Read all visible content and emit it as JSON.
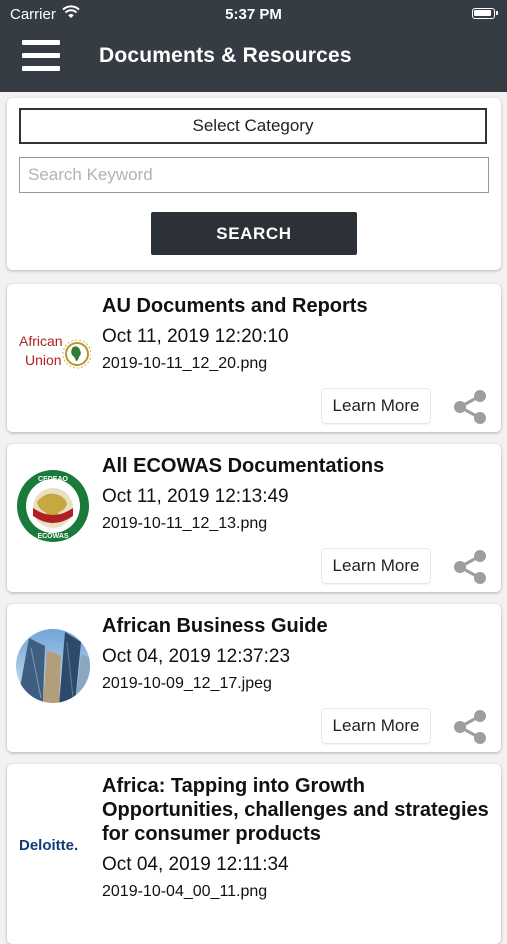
{
  "status_bar": {
    "carrier": "Carrier",
    "time": "5:37 PM"
  },
  "nav": {
    "title": "Documents & Resources"
  },
  "search": {
    "category_label": "Select Category",
    "keyword_placeholder": "Search Keyword",
    "button_label": "SEARCH"
  },
  "documents": [
    {
      "title": "AU Documents and Reports",
      "date": "Oct 11, 2019 12:20:10",
      "file": "2019-10-11_12_20.png",
      "logo": "african-union-logo",
      "logo_text": [
        "African",
        "Union"
      ],
      "learn_more": "Learn More"
    },
    {
      "title": "All ECOWAS Documentations",
      "date": "Oct 11, 2019 12:13:49",
      "file": "2019-10-11_12_13.png",
      "logo": "ecowas-logo",
      "logo_text": [
        "CEDEAO",
        "ECOWAS"
      ],
      "learn_more": "Learn More"
    },
    {
      "title": "African Business Guide",
      "date": "Oct 04, 2019 12:37:23",
      "file": "2019-10-09_12_17.jpeg",
      "logo": "skyscrapers-photo",
      "learn_more": "Learn More"
    },
    {
      "title": "Africa: Tapping into Growth Opportunities, challenges and strategies for consumer products",
      "date": "Oct 04, 2019 12:11:34",
      "file": "2019-10-04_00_11.png",
      "logo": "deloitte-logo",
      "logo_text": [
        "Deloitte."
      ],
      "learn_more": "Learn More"
    }
  ],
  "colors": {
    "header": "#353c44",
    "button": "#2c3037",
    "au_red": "#b01f24",
    "ecowas_green": "#1a7a3a",
    "deloitte_blue": "#0f3c7a"
  },
  "icons": {
    "menu": "hamburger-icon",
    "share": "share-icon",
    "wifi": "wifi-icon",
    "battery": "battery-icon"
  }
}
